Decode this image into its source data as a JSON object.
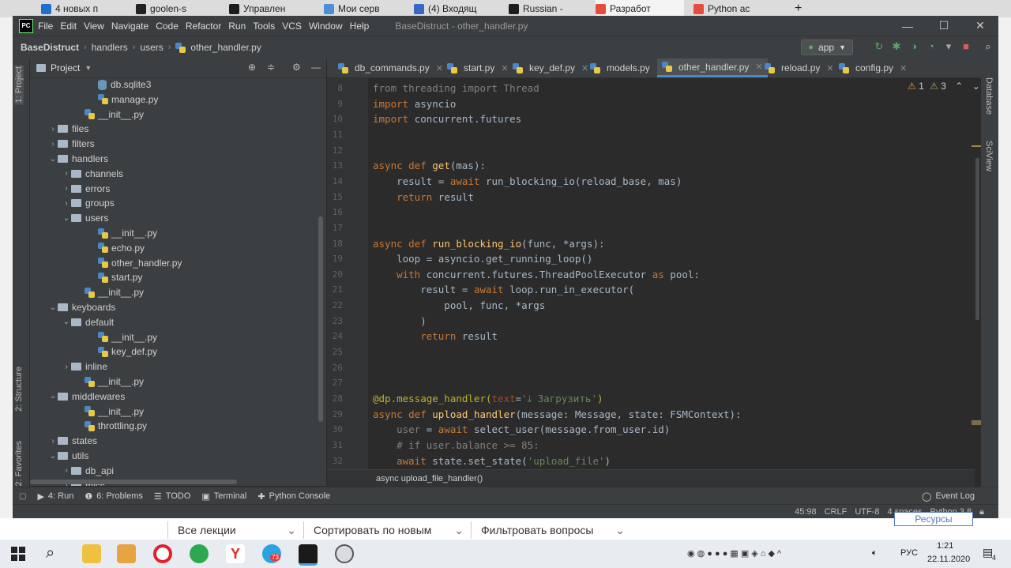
{
  "browser_tabs": [
    {
      "label": "4 новых п",
      "color": "#1f6fd1"
    },
    {
      "label": "goolen-s",
      "color": "#222222"
    },
    {
      "label": "Управлен",
      "color": "#1d1d1d"
    },
    {
      "label": "Мои серв",
      "color": "#4a90d9"
    },
    {
      "label": "(4) Входящ",
      "color": "#3b66c4"
    },
    {
      "label": "Russian -",
      "color": "#1d1d1d"
    },
    {
      "label": "Разработ",
      "color": "#e44c3d"
    },
    {
      "label": "Python ас",
      "color": "#e44c3d"
    }
  ],
  "menubar": {
    "logo": "PC",
    "items": [
      "File",
      "Edit",
      "View",
      "Navigate",
      "Code",
      "Refactor",
      "Run",
      "Tools",
      "VCS",
      "Window",
      "Help"
    ],
    "title": "BaseDistruct - other_handler.py",
    "window_controls": [
      "—",
      "☐",
      "✕"
    ]
  },
  "navbar": {
    "breadcrumbs": [
      "BaseDistruct",
      "handlers",
      "users",
      "other_handler.py"
    ],
    "run_config": "app"
  },
  "left_stripe": {
    "tabs": [
      "1: Project",
      "2: Structure",
      "2: Favorites"
    ]
  },
  "project": {
    "title": "Project",
    "tree": [
      {
        "name": "db.sqlite3",
        "type": "db",
        "depth": 4,
        "arrow": ""
      },
      {
        "name": "manage.py",
        "type": "py",
        "depth": 4,
        "arrow": ""
      },
      {
        "name": "__init__.py",
        "type": "py",
        "depth": 3,
        "arrow": ""
      },
      {
        "name": "files",
        "type": "folder",
        "depth": 1,
        "arrow": "›"
      },
      {
        "name": "filters",
        "type": "folder",
        "depth": 1,
        "arrow": "›"
      },
      {
        "name": "handlers",
        "type": "folder",
        "depth": 1,
        "arrow": "⌄"
      },
      {
        "name": "channels",
        "type": "folder",
        "depth": 2,
        "arrow": "›"
      },
      {
        "name": "errors",
        "type": "folder",
        "depth": 2,
        "arrow": "›"
      },
      {
        "name": "groups",
        "type": "folder",
        "depth": 2,
        "arrow": "›"
      },
      {
        "name": "users",
        "type": "folder",
        "depth": 2,
        "arrow": "⌄"
      },
      {
        "name": "__init__.py",
        "type": "py",
        "depth": 4,
        "arrow": ""
      },
      {
        "name": "echo.py",
        "type": "py",
        "depth": 4,
        "arrow": ""
      },
      {
        "name": "other_handler.py",
        "type": "py",
        "depth": 4,
        "arrow": ""
      },
      {
        "name": "start.py",
        "type": "py",
        "depth": 4,
        "arrow": ""
      },
      {
        "name": "__init__.py",
        "type": "py",
        "depth": 3,
        "arrow": ""
      },
      {
        "name": "keyboards",
        "type": "folder",
        "depth": 1,
        "arrow": "⌄"
      },
      {
        "name": "default",
        "type": "folder",
        "depth": 2,
        "arrow": "⌄"
      },
      {
        "name": "__init__.py",
        "type": "py",
        "depth": 4,
        "arrow": ""
      },
      {
        "name": "key_def.py",
        "type": "py",
        "depth": 4,
        "arrow": ""
      },
      {
        "name": "inline",
        "type": "folder",
        "depth": 2,
        "arrow": "›"
      },
      {
        "name": "__init__.py",
        "type": "py",
        "depth": 3,
        "arrow": ""
      },
      {
        "name": "middlewares",
        "type": "folder",
        "depth": 1,
        "arrow": "⌄"
      },
      {
        "name": "__init__.py",
        "type": "py",
        "depth": 3,
        "arrow": ""
      },
      {
        "name": "throttling.py",
        "type": "py",
        "depth": 3,
        "arrow": ""
      },
      {
        "name": "states",
        "type": "folder",
        "depth": 1,
        "arrow": "›"
      },
      {
        "name": "utils",
        "type": "folder",
        "depth": 1,
        "arrow": "⌄"
      },
      {
        "name": "db_api",
        "type": "folder",
        "depth": 2,
        "arrow": "›"
      },
      {
        "name": "misc",
        "type": "folder",
        "depth": 2,
        "arrow": "›"
      }
    ]
  },
  "editor_tabs": [
    {
      "label": "db_commands.py",
      "active": false
    },
    {
      "label": "start.py",
      "active": false
    },
    {
      "label": "key_def.py",
      "active": false
    },
    {
      "label": "models.py",
      "active": false
    },
    {
      "label": "other_handler.py",
      "active": true
    },
    {
      "label": "reload.py",
      "active": false
    },
    {
      "label": "config.py",
      "active": false
    }
  ],
  "inspections": {
    "warnings": "1",
    "weak_warnings": "3"
  },
  "code_lines": [
    {
      "n": "8",
      "tokens": [
        [
          "cm",
          "from threading import Thread"
        ]
      ]
    },
    {
      "n": "9",
      "tokens": [
        [
          "kw",
          "import "
        ],
        [
          "",
          "asyncio"
        ]
      ]
    },
    {
      "n": "10",
      "tokens": [
        [
          "kw",
          "import "
        ],
        [
          "",
          "concurrent.futures"
        ]
      ]
    },
    {
      "n": "11",
      "tokens": []
    },
    {
      "n": "12",
      "tokens": []
    },
    {
      "n": "13",
      "tokens": [
        [
          "kw",
          "async def "
        ],
        [
          "fn",
          "get"
        ],
        [
          "",
          "(mas):"
        ]
      ]
    },
    {
      "n": "14",
      "tokens": [
        [
          "",
          "    result = "
        ],
        [
          "kw",
          "await "
        ],
        [
          "",
          "run_blocking_io(reload_base, mas)"
        ]
      ]
    },
    {
      "n": "15",
      "tokens": [
        [
          "",
          "    "
        ],
        [
          "kw",
          "return "
        ],
        [
          "",
          "result"
        ]
      ]
    },
    {
      "n": "16",
      "tokens": []
    },
    {
      "n": "17",
      "tokens": []
    },
    {
      "n": "18",
      "tokens": [
        [
          "kw",
          "async def "
        ],
        [
          "fn",
          "run_blocking_io"
        ],
        [
          "",
          "(func, *args):"
        ]
      ]
    },
    {
      "n": "19",
      "tokens": [
        [
          "",
          "    loop = asyncio.get_running_loop()"
        ]
      ]
    },
    {
      "n": "20",
      "tokens": [
        [
          "",
          "    "
        ],
        [
          "kw",
          "with "
        ],
        [
          "",
          "concurrent.futures.ThreadPoolExecutor "
        ],
        [
          "kw",
          "as "
        ],
        [
          "",
          "pool:"
        ]
      ]
    },
    {
      "n": "21",
      "tokens": [
        [
          "",
          "        result = "
        ],
        [
          "kw",
          "await "
        ],
        [
          "",
          "loop.run_in_executor("
        ]
      ]
    },
    {
      "n": "22",
      "tokens": [
        [
          "",
          "            pool, func, *args"
        ]
      ]
    },
    {
      "n": "23",
      "tokens": [
        [
          "",
          "        )"
        ]
      ]
    },
    {
      "n": "24",
      "tokens": [
        [
          "",
          "        "
        ],
        [
          "kw",
          "return "
        ],
        [
          "",
          "result"
        ]
      ]
    },
    {
      "n": "25",
      "tokens": []
    },
    {
      "n": "26",
      "tokens": []
    },
    {
      "n": "27",
      "tokens": []
    },
    {
      "n": "28",
      "tokens": [
        [
          "dec",
          "@dp.message_handler("
        ],
        [
          "par",
          "text"
        ],
        [
          "",
          "="
        ],
        [
          "st",
          "'⤓ Загрузить'"
        ],
        [
          "dec",
          ")"
        ]
      ]
    },
    {
      "n": "29",
      "tokens": [
        [
          "kw",
          "async def "
        ],
        [
          "fn",
          "upload_handler"
        ],
        [
          "",
          "(message: Message, state: FSMContext):"
        ]
      ]
    },
    {
      "n": "30",
      "tokens": [
        [
          "",
          "    "
        ],
        [
          "cm",
          "user"
        ],
        [
          "",
          " = "
        ],
        [
          "kw",
          "await "
        ],
        [
          "",
          "select_user(message.from_user.id)"
        ]
      ]
    },
    {
      "n": "31",
      "tokens": [
        [
          "cm",
          "    # if user.balance >= 85:"
        ]
      ]
    },
    {
      "n": "32",
      "tokens": [
        [
          "",
          "    "
        ],
        [
          "kw",
          "await "
        ],
        [
          "",
          "state.set_state("
        ],
        [
          "st",
          "'upload_file'"
        ],
        [
          "",
          ")"
        ]
      ]
    }
  ],
  "code_breadcrumb": "async upload_file_handler()",
  "right_stripe": {
    "tabs": [
      "Database",
      "SciView"
    ]
  },
  "tool_tabs": [
    {
      "icon": "▶",
      "label": "4: Run"
    },
    {
      "icon": "❶",
      "label": "6: Problems"
    },
    {
      "icon": "☰",
      "label": "TODO"
    },
    {
      "icon": "▣",
      "label": "Terminal"
    },
    {
      "icon": "✚",
      "label": "Python Console"
    }
  ],
  "event_log": "Event Log",
  "status": {
    "position": "45:98",
    "line_sep": "CRLF",
    "encoding": "UTF-8",
    "indent": "4 spaces",
    "interpreter": "Python 3.8"
  },
  "webpage": {
    "selects": [
      "Все лекции",
      "Сортировать по новым",
      "Фильтровать вопросы"
    ],
    "right_button": "Ресурсы"
  },
  "taskbar": {
    "lang": "РУС",
    "time": "1:21",
    "date": "22.11.2020",
    "badge": "73",
    "notifications": "4"
  }
}
